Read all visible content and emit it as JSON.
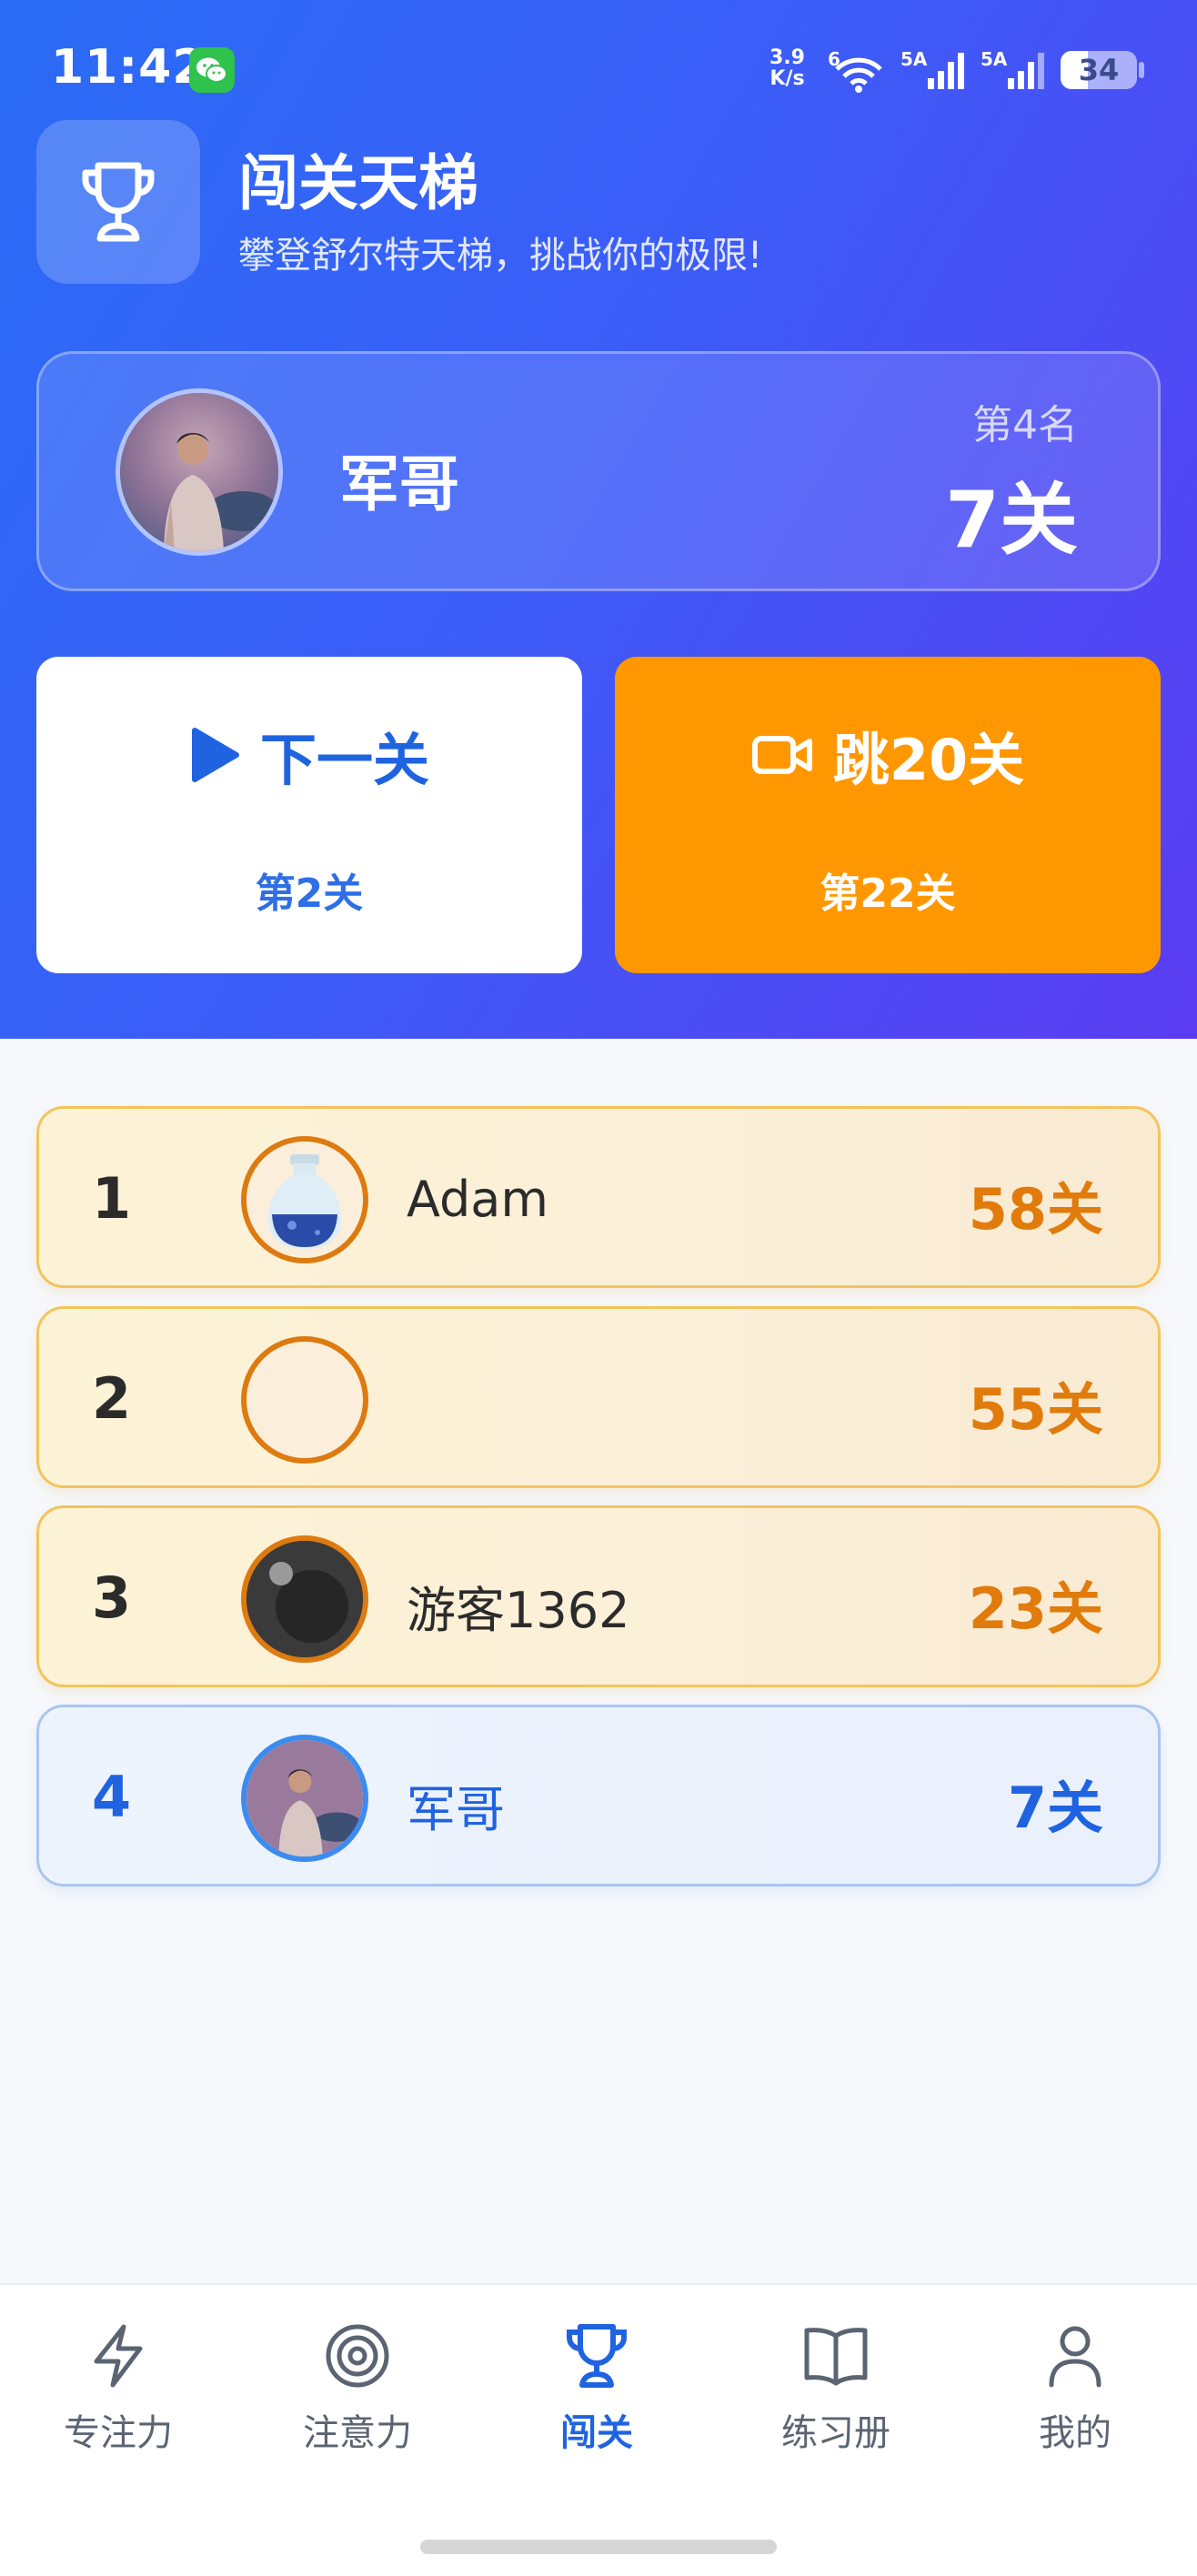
{
  "status_bar": {
    "time": "11:42",
    "net_speed_value": "3.9",
    "net_speed_unit": "K/s",
    "wifi_label": "6",
    "sim1_label": "5A",
    "sim2_label": "5A",
    "battery": "34"
  },
  "header": {
    "title": "闯关天梯",
    "subtitle": "攀登舒尔特天梯，挑战你的极限!",
    "icon": "trophy-icon"
  },
  "user_card": {
    "name": "军哥",
    "rank": "第4名",
    "level": "7关"
  },
  "actions": {
    "next": {
      "label": "下一关",
      "sub": "第2关",
      "icon": "play-icon"
    },
    "skip": {
      "label": "跳20关",
      "sub": "第22关",
      "icon": "video-icon"
    }
  },
  "leaderboard": [
    {
      "rank": "1",
      "name": "Adam",
      "score": "58关",
      "avatar": "potion-avatar"
    },
    {
      "rank": "2",
      "name": "",
      "score": "55关",
      "avatar": "empty-avatar"
    },
    {
      "rank": "3",
      "name": "游客1362",
      "score": "23关",
      "avatar": "dark-ball-avatar"
    },
    {
      "rank": "4",
      "name": "军哥",
      "score": "7关",
      "avatar": "photo-avatar"
    }
  ],
  "bottom_nav": [
    {
      "label": "专注力",
      "icon": "lightning-icon",
      "active": false
    },
    {
      "label": "注意力",
      "icon": "target-icon",
      "active": false
    },
    {
      "label": "闯关",
      "icon": "trophy-icon",
      "active": true
    },
    {
      "label": "练习册",
      "icon": "book-icon",
      "active": false
    },
    {
      "label": "我的",
      "icon": "person-icon",
      "active": false
    }
  ],
  "colors": {
    "hero_start": "#2a6cf6",
    "hero_end": "#5b3cf2",
    "accent_blue": "#1f63e0",
    "accent_orange": "#ff9800",
    "score_orange": "#e07b0c"
  }
}
